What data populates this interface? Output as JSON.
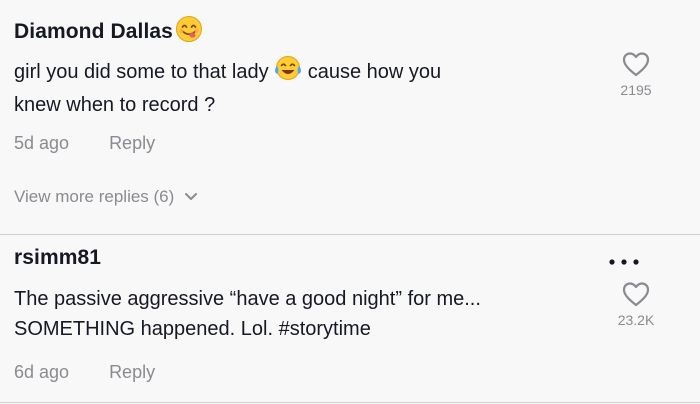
{
  "comments": [
    {
      "username": "Diamond Dallas",
      "username_emoji": "yum-face-emoji",
      "text_line1_before": "girl you did some to that lady ",
      "text_line1_emoji": "tears-of-joy-emoji",
      "text_line1_after": " cause how you",
      "text_line2": "knew when to record ?",
      "age": "5d ago",
      "reply_label": "Reply",
      "likes": "2195"
    },
    {
      "username": "rsimm81",
      "text_line1": "The passive aggressive “have a good night” for me...",
      "text_line2": "SOMETHING happened. Lol. #storytime",
      "age": "6d ago",
      "reply_label": "Reply",
      "likes": "23.2K"
    }
  ],
  "view_more_replies": "View more replies (6)",
  "icons": {
    "heart": "heart-outline-icon",
    "chevron": "chevron-down-icon",
    "more": "more-dots-icon"
  },
  "colors": {
    "text_primary": "#161823",
    "text_secondary": "#8a8b91",
    "background": "#f8f8f8"
  }
}
